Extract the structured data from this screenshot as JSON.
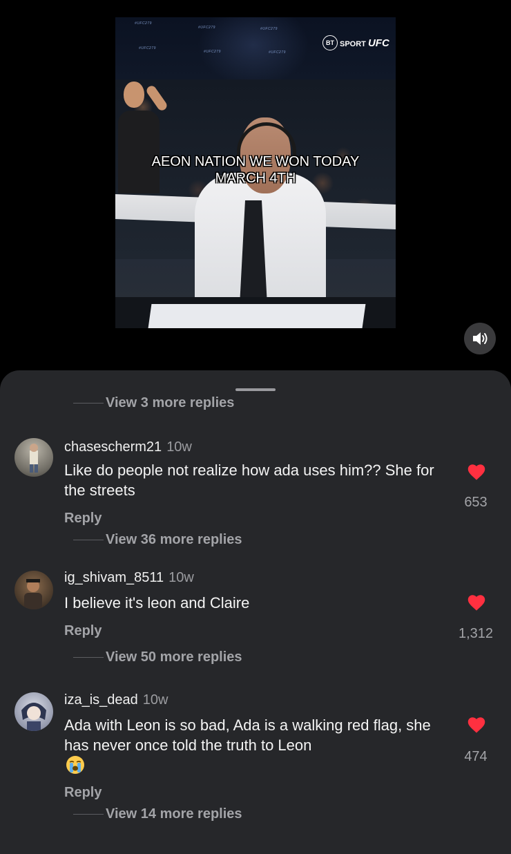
{
  "video": {
    "caption_line1": "AEON NATION WE WON TODAY",
    "caption_line2": "MARCH 4TH",
    "broadcaster_badge": "BT",
    "broadcaster_sport": "SPORT",
    "broadcaster_brand": "UFC",
    "banner_text": "#UFC279"
  },
  "sound_icon": "speaker-icon",
  "sheet": {
    "top_partial_replies": "View 3 more replies",
    "comments": [
      {
        "username": "chasescherm21",
        "time": "10w",
        "text": "Like do people not realize how ada uses him?? She for the streets",
        "likes": "653",
        "reply_label": "Reply",
        "view_replies": "View 36 more replies"
      },
      {
        "username": "ig_shivam_8511",
        "time": "10w",
        "text": "I believe it's leon and Claire",
        "likes": "1,312",
        "reply_label": "Reply",
        "view_replies": "View 50 more replies"
      },
      {
        "username": "iza_is_dead",
        "time": "10w",
        "text": "Ada with Leon is so bad, Ada is a walking red flag, she has never once told the truth to Leon",
        "likes": "474",
        "reply_label": "Reply",
        "view_replies": "View 14 more replies"
      }
    ]
  },
  "colors": {
    "sheet_bg": "#26272a",
    "heart": "#ff3040",
    "secondary_text": "#a3a4a8"
  }
}
